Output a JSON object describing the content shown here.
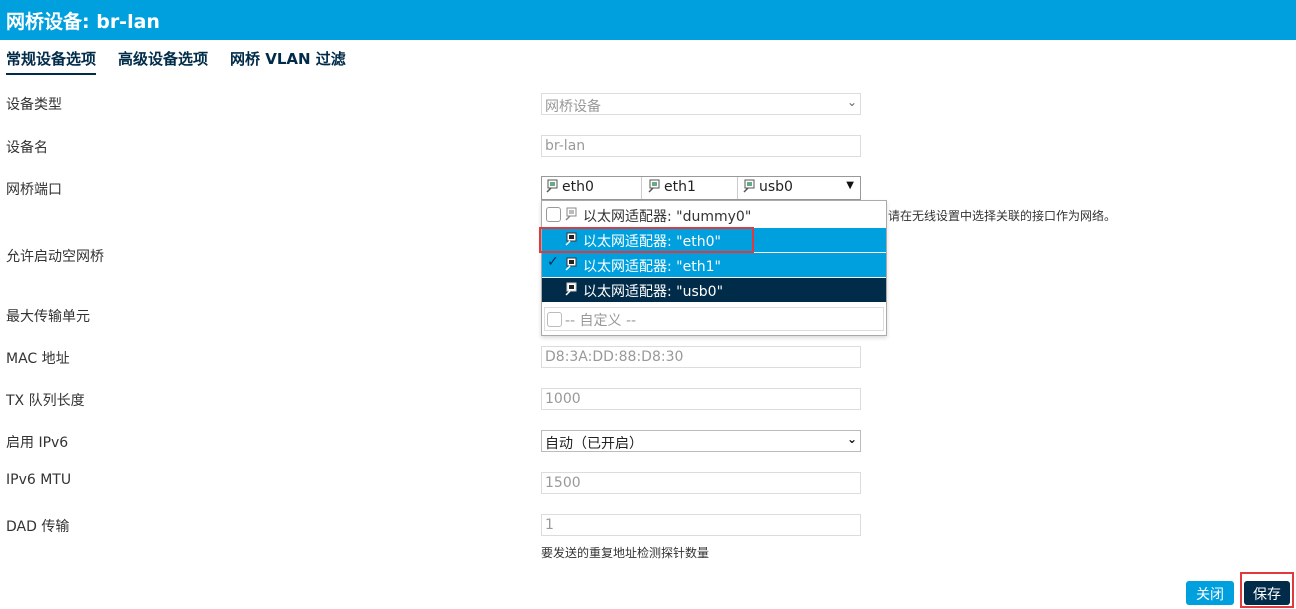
{
  "window": {
    "title": "网桥设备: br-lan"
  },
  "tabs": [
    {
      "label": "常规设备选项",
      "active": true
    },
    {
      "label": "高级设备选项",
      "active": false
    },
    {
      "label": "网桥 VLAN 过滤",
      "active": false
    }
  ],
  "form": {
    "device_type": {
      "label": "设备类型",
      "value": "网桥设备"
    },
    "device_name": {
      "label": "设备名",
      "value": "br-lan"
    },
    "bridge_ports": {
      "label": "网桥端口",
      "selected": [
        "eth0",
        "eth1",
        "usb0"
      ],
      "hint": "请在无线设置中选择关联的接口作为网络。",
      "options": [
        {
          "label": "以太网适配器: \"dummy0\"",
          "checked": false
        },
        {
          "label": "以太网适配器: \"eth0\"",
          "checked": false
        },
        {
          "label": "以太网适配器: \"eth1\"",
          "checked": true
        },
        {
          "label": "以太网适配器: \"usb0\"",
          "checked": false
        }
      ],
      "custom_placeholder": "-- 自定义 --"
    },
    "allow_empty_bridge": {
      "label": "允许启动空网桥"
    },
    "mtu": {
      "label": "最大传输单元"
    },
    "mac": {
      "label": "MAC 地址",
      "placeholder": "D8:3A:DD:88:D8:30"
    },
    "txqueuelen": {
      "label": "TX 队列长度",
      "placeholder": "1000"
    },
    "ipv6": {
      "label": "启用 IPv6",
      "value": "自动（已开启）"
    },
    "ipv6_mtu": {
      "label": "IPv6 MTU",
      "placeholder": "1500"
    },
    "dad": {
      "label": "DAD 传输",
      "placeholder": "1",
      "hint": "要发送的重复地址检测探针数量"
    }
  },
  "footer": {
    "close_label": "关闭",
    "save_label": "保存"
  },
  "colors": {
    "header": "#00a0df",
    "selected_option": "#00a0df",
    "hover_option": "#002b49",
    "save_button": "#002b49",
    "highlight": "#e0393e"
  }
}
